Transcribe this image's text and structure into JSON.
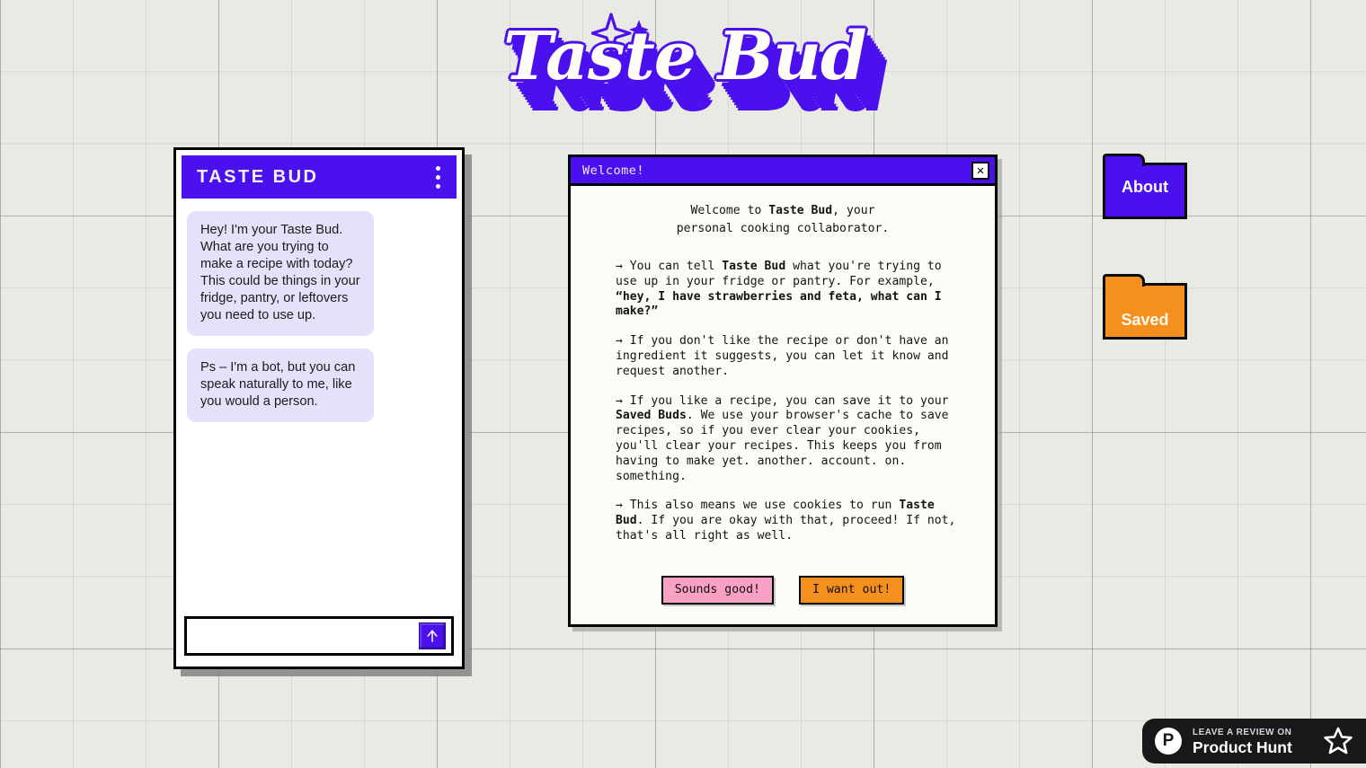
{
  "brand": {
    "logo_text": "Taste Bud",
    "accent_purple": "#4B10EE",
    "accent_orange": "#F5901F",
    "accent_pink": "#F9A0C6",
    "background": "#EAEAE4",
    "sparkle_icon": "sparkle-star-icon"
  },
  "chat": {
    "title": "TASTE BUD",
    "menu_icon": "three-dot-menu-icon",
    "messages": [
      {
        "author": "bot",
        "text": "Hey! I'm your Taste Bud. What are you trying to make a recipe with today? This could be things in your fridge, pantry, or leftovers you need to use up."
      },
      {
        "author": "bot",
        "text": "Ps – I'm a bot, but you can speak naturally to me, like you would a person."
      }
    ],
    "input": {
      "value": "",
      "placeholder": ""
    },
    "send_icon": "up-arrow-icon"
  },
  "modal": {
    "title": "Welcome!",
    "close_icon": "close-x-icon",
    "heading_line1_a": "Welcome to ",
    "heading_line1_b": "Taste Bud",
    "heading_line1_c": ", your",
    "heading_line2": "personal cooking collaborator.",
    "paragraphs": [
      {
        "id": "p1",
        "segments": [
          {
            "text": "→ You can tell ",
            "bold": false
          },
          {
            "text": "Taste Bud",
            "bold": true
          },
          {
            "text": " what you're trying to use up in your fridge or pantry. For example, ",
            "bold": false
          },
          {
            "text": "“hey, I have strawberries and feta, what can I make?”",
            "bold": true
          }
        ]
      },
      {
        "id": "p2",
        "segments": [
          {
            "text": "→ If you don't like the recipe or don't have an ingredient it suggests, you can let it know and request another.",
            "bold": false
          }
        ]
      },
      {
        "id": "p3",
        "segments": [
          {
            "text": "→ If you like a recipe, you can save it to your ",
            "bold": false
          },
          {
            "text": "Saved Buds",
            "bold": true
          },
          {
            "text": ". We use your browser's cache to save recipes, so if you ever clear your cookies, you'll clear your recipes. This keeps you from having to make yet. another. account. on. something.",
            "bold": false
          }
        ]
      },
      {
        "id": "p4",
        "segments": [
          {
            "text": "→ This also means we use cookies to run ",
            "bold": false
          },
          {
            "text": "Taste Bud",
            "bold": true
          },
          {
            "text": ". If you are okay with that, proceed! If not, that's all right as well.",
            "bold": false
          }
        ]
      }
    ],
    "accept_label": "Sounds good!",
    "decline_label": "I want out!"
  },
  "folders": [
    {
      "id": "about",
      "label": "About",
      "color": "#4B10EE"
    },
    {
      "id": "saved",
      "label": "Saved",
      "color": "#F5901F"
    }
  ],
  "product_hunt": {
    "logo_letter": "P",
    "kicker": "LEAVE A REVIEW ON",
    "name": "Product Hunt",
    "star_icon": "star-outline-icon"
  }
}
